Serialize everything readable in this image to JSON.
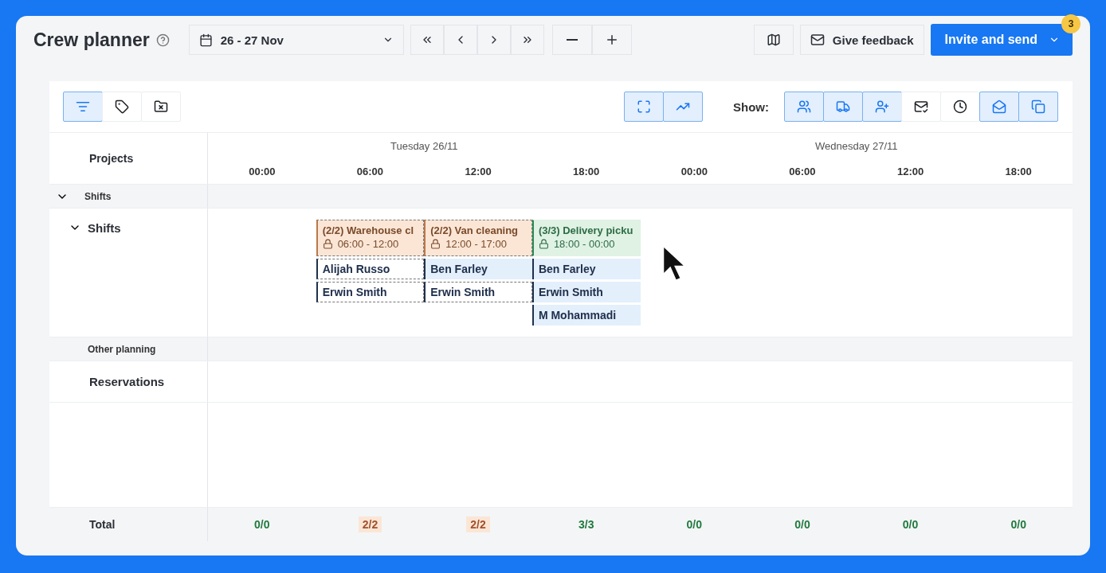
{
  "header": {
    "title": "Crew planner",
    "date_range": "26 - 27 Nov",
    "feedback": "Give feedback",
    "invite": "Invite and send",
    "badge": "3"
  },
  "toolbar": {
    "left": [
      {
        "kind": "filter",
        "selected": true
      },
      {
        "kind": "tag",
        "selected": false
      },
      {
        "kind": "folder",
        "selected": false
      }
    ],
    "view": [
      {
        "kind": "fit",
        "selected": true
      },
      {
        "kind": "chart",
        "selected": true
      }
    ],
    "show_label": "Show:",
    "show": [
      {
        "kind": "people",
        "selected": true
      },
      {
        "kind": "truck",
        "selected": true
      },
      {
        "kind": "person-add",
        "selected": true
      },
      {
        "kind": "mail-check",
        "selected": false
      },
      {
        "kind": "mail-clock",
        "selected": false
      },
      {
        "kind": "mail-open",
        "selected": true
      },
      {
        "kind": "copy",
        "selected": true
      }
    ]
  },
  "grid": {
    "projects_label": "Projects",
    "days": [
      "Tuesday 26/11",
      "Wednesday 27/11"
    ],
    "times": [
      "00:00",
      "06:00",
      "12:00",
      "18:00",
      "00:00",
      "06:00",
      "12:00",
      "18:00"
    ],
    "group_shifts": {
      "label": "Shifts",
      "expanded": true
    },
    "shift_row": {
      "label": "Shifts",
      "expanded": true
    },
    "shifts": [
      {
        "title": "(2/2) Warehouse cl",
        "time": "06:00 - 12:00",
        "color": "#fbe6d6",
        "confirmed": false,
        "people": [
          {
            "name": "Alijah Russo",
            "confirmed": false
          },
          {
            "name": "Erwin Smith",
            "confirmed": false
          }
        ]
      },
      {
        "title": "(2/2) Van cleaning",
        "time": "12:00 - 17:00",
        "color": "#fbe6d6",
        "confirmed": false,
        "people": [
          {
            "name": "Ben Farley",
            "confirmed": true
          },
          {
            "name": "Erwin Smith",
            "confirmed": false
          }
        ]
      },
      {
        "title": "(3/3) Delivery picku",
        "time": "18:00 - 00:00",
        "color": "#dff2e4",
        "confirmed": true,
        "people": [
          {
            "name": "Ben Farley",
            "confirmed": true
          },
          {
            "name": "Erwin Smith",
            "confirmed": true
          },
          {
            "name": "M Mohammadi",
            "confirmed": true
          }
        ]
      }
    ],
    "group_other": "Other planning",
    "reservations_label": "Reservations",
    "total_label": "Total",
    "totals": [
      {
        "value": "0/0",
        "color": "#1f7a3d"
      },
      {
        "value": "2/2",
        "color": "#a0522d"
      },
      {
        "value": "2/2",
        "color": "#a0522d"
      },
      {
        "value": "3/3",
        "color": "#1f7a3d"
      },
      {
        "value": "0/0",
        "color": "#1f7a3d"
      },
      {
        "value": "0/0",
        "color": "#1f7a3d"
      },
      {
        "value": "0/0",
        "color": "#1f7a3d"
      },
      {
        "value": "0/0",
        "color": "#1f7a3d"
      }
    ]
  }
}
